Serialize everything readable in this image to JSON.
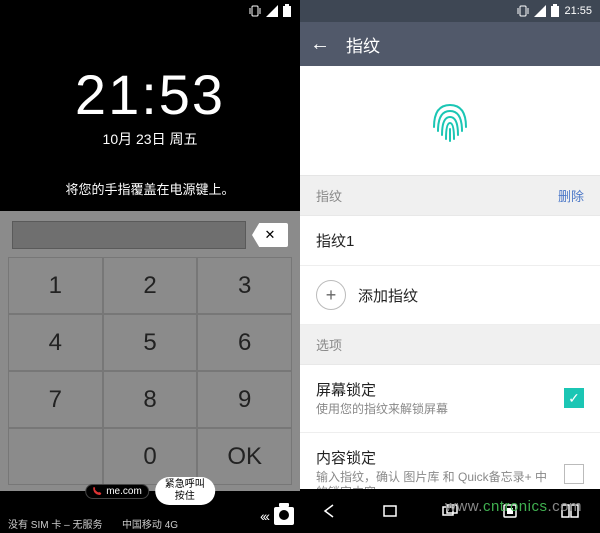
{
  "left": {
    "status_time": "",
    "time": "21:53",
    "date": "10月 23日 周五",
    "hint": "将您的手指覆盖在电源键上。",
    "keys": [
      "1",
      "2",
      "3",
      "4",
      "5",
      "6",
      "7",
      "8",
      "9",
      "",
      "0",
      "OK"
    ],
    "emergency_prefix": "me.com",
    "emergency_label": "紧急呼叫\n按住",
    "sim_status": "没有 SIM 卡 – 无服务",
    "carrier": "中国移动 4G"
  },
  "right": {
    "status_time": "21:55",
    "header": "指纹",
    "section_fp": "指纹",
    "delete_action": "删除",
    "fp1": "指纹1",
    "add_fp": "添加指纹",
    "section_opts": "选项",
    "screen_lock_title": "屏幕锁定",
    "screen_lock_sub": "使用您的指纹来解锁屏幕",
    "content_lock_title": "内容锁定",
    "content_lock_sub": "输入指纹，确认 图片库 和 Quick备忘录+ 中的锁定内容"
  },
  "watermark_prefix": "www.",
  "watermark_main": "cntronics",
  "watermark_suffix": ".com"
}
